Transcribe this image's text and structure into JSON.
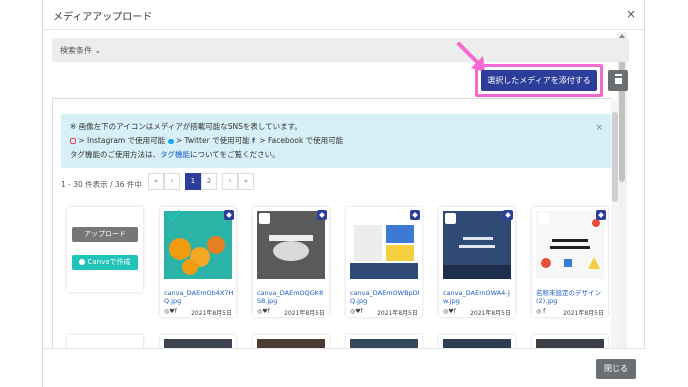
{
  "modal": {
    "title": "メディアアップロード",
    "close_glyph": "×"
  },
  "search": {
    "label": "検索条件 ⌄"
  },
  "actions": {
    "attach_label": "選択したメディアを添付する",
    "highlight_color": "#f56ad0"
  },
  "info": {
    "line1": "※ 画像左下のアイコンはメディアが搭載可能なSNSを表しています。",
    "line2_ig": "> Instagram で使用可能",
    "line2_tw": "> Twitter で使用可能",
    "line2_fb": "> Facebook で使用可能",
    "line3_pre": "タグ機能のご使用方法は、",
    "line3_link": "タグ機能",
    "line3_post": "についてをご覧ください。",
    "close_glyph": "×"
  },
  "listing": {
    "count_text": "1 - 30 件表示 / 36 件中",
    "pages": [
      "«",
      "‹",
      "1",
      "2",
      "›",
      "»"
    ],
    "active_page": "1"
  },
  "upload": {
    "upload_label": "アップロード",
    "canva_label": "Canvaで作成"
  },
  "cards": [
    {
      "name": "canva_DAEmOb4X7HQ.jpg",
      "date": "2021年8月5日",
      "sns": "◎♥f",
      "img_color": "#2bb3a8",
      "checked": true
    },
    {
      "name": "canva_DAEmOQGK8S8.jpg",
      "date": "2021年8月5日",
      "sns": "◎♥f",
      "img_color": "#5a5a5a",
      "checked": false
    },
    {
      "name": "canva_DAEmOWBpDIQ.jpg",
      "date": "2021年8月5日",
      "sns": "◎♥f",
      "img_color": "#f4d03f",
      "checked": false
    },
    {
      "name": "canva_DAEmOWA4-Jw.jpg",
      "date": "2021年8月5日",
      "sns": "◎♥f",
      "img_color": "#2f4a74",
      "checked": false
    },
    {
      "name": "名称未設定のデザイン (2).jpg",
      "date": "2021年8月5日",
      "sns": "◎ f",
      "img_color": "#f7f7f7",
      "checked": false
    }
  ],
  "footer": {
    "close_label": "閉じる"
  }
}
